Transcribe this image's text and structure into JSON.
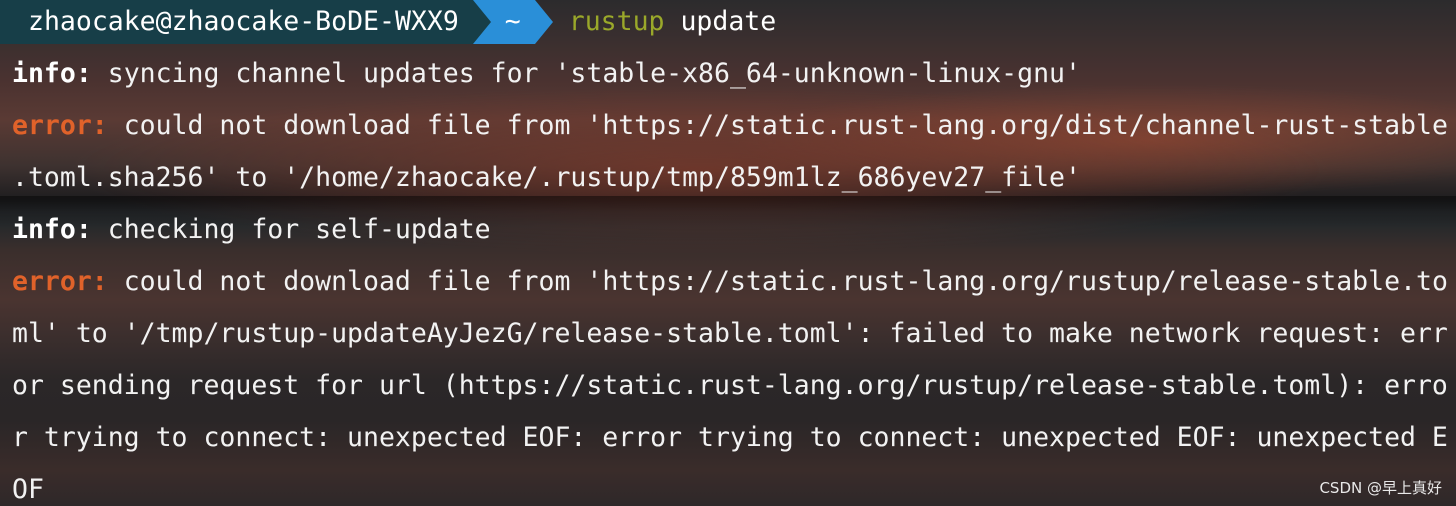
{
  "prompt": {
    "user_host": "zhaocake@zhaocake-BoDE-WXX9",
    "directory": "~",
    "command": "rustup",
    "argument": "update"
  },
  "colors": {
    "prompt_user_bg": "#173e48",
    "prompt_dir_bg": "#2a8fd8",
    "command": "#9aa82a",
    "error_label": "#e0622a",
    "text": "#f2f2f2"
  },
  "output": [
    {
      "label": "info:",
      "type": "info",
      "text": " syncing channel updates for 'stable-x86_64-unknown-linux-gnu'"
    },
    {
      "label": "error:",
      "type": "error",
      "text": " could not download file from 'https://static.rust-lang.org/dist/channel-rust-stable"
    },
    {
      "label": "",
      "type": "plain",
      "text": ".toml.sha256' to '/home/zhaocake/.rustup/tmp/859m1lz_686yev27_file'"
    },
    {
      "label": "info:",
      "type": "info",
      "text": " checking for self-update"
    },
    {
      "label": "error:",
      "type": "error",
      "text": " could not download file from 'https://static.rust-lang.org/rustup/release-stable.to"
    },
    {
      "label": "",
      "type": "plain",
      "text": "ml' to '/tmp/rustup-updateAyJezG/release-stable.toml': failed to make network request: err"
    },
    {
      "label": "",
      "type": "plain",
      "text": "or sending request for url (https://static.rust-lang.org/rustup/release-stable.toml): erro"
    },
    {
      "label": "",
      "type": "plain",
      "text": "r trying to connect: unexpected EOF: error trying to connect: unexpected EOF: unexpected E"
    },
    {
      "label": "",
      "type": "plain",
      "text": "OF"
    }
  ],
  "watermark": "CSDN @早上真好"
}
